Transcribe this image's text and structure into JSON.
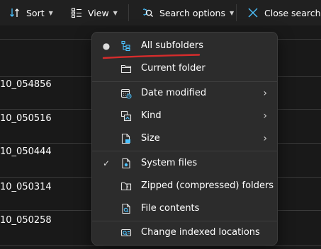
{
  "toolbar": {
    "sort": {
      "label": "Sort",
      "icon": "sort-icon"
    },
    "view": {
      "label": "View",
      "icon": "view-icon"
    },
    "search_options": {
      "label": "Search options",
      "icon": "search-options-icon"
    },
    "close_search": {
      "label": "Close search",
      "icon": "close-icon"
    }
  },
  "file_list": {
    "rows": [
      {
        "name": "10_054856"
      },
      {
        "name": "10_050516"
      },
      {
        "name": "10_050444"
      },
      {
        "name": "10_050314"
      },
      {
        "name": "10_050258"
      }
    ]
  },
  "search_menu": {
    "items": [
      {
        "label": "All subfolders",
        "icon": "subfolders-icon",
        "selected": true
      },
      {
        "label": "Current folder",
        "icon": "folder-icon",
        "selected": false
      },
      {
        "label": "Date modified",
        "icon": "calendar-icon",
        "has_submenu": true
      },
      {
        "label": "Kind",
        "icon": "kind-icon",
        "has_submenu": true
      },
      {
        "label": "Size",
        "icon": "size-icon",
        "has_submenu": true
      },
      {
        "label": "System files",
        "icon": "system-file-icon",
        "checked": true
      },
      {
        "label": "Zipped (compressed) folders",
        "icon": "zip-folder-icon",
        "checked": false
      },
      {
        "label": "File contents",
        "icon": "file-search-icon",
        "checked": false
      },
      {
        "label": "Change indexed locations",
        "icon": "indexed-locations-icon"
      }
    ],
    "highlight_color": "#d62c2c",
    "accent_color": "#4cc2ff"
  }
}
